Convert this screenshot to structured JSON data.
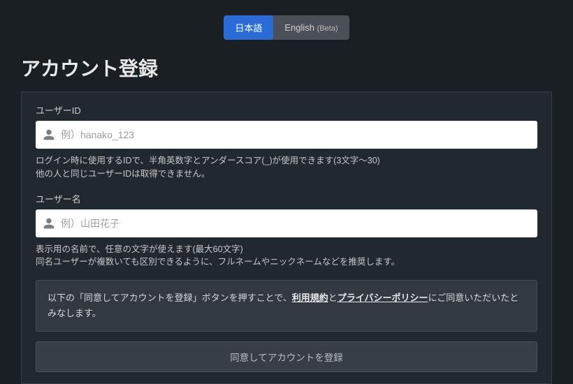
{
  "lang": {
    "ja": "日本語",
    "en": "English",
    "en_beta": "(Beta)"
  },
  "title": "アカウント登録",
  "userId": {
    "label": "ユーザーID",
    "placeholder": "例）hanako_123",
    "help1": "ログイン時に使用するIDで、半角英数字とアンダースコア(_)が使用できます(3文字〜30)",
    "help2": "他の人と同じユーザーIDは取得できません。"
  },
  "userName": {
    "label": "ユーザー名",
    "placeholder": "例）山田花子",
    "help1": "表示用の名前で、任意の文字が使えます(最大60文字)",
    "help2": "同名ユーザーが複数いても区別できるように、フルネームやニックネームなどを推奨します。"
  },
  "consent": {
    "pre": "以下の「同意してアカウントを登録」ボタンを押すことで、",
    "tos": "利用規約",
    "and": "と",
    "privacy": "プライバシーポリシー",
    "post": "にご同意いただいたとみなします。"
  },
  "submit": "同意してアカウントを登録"
}
